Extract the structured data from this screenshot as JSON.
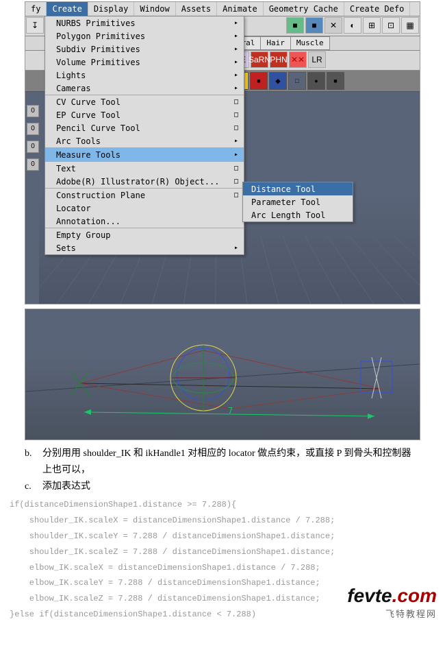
{
  "menu": {
    "items": [
      "fy",
      "Create",
      "Display",
      "Window",
      "Assets",
      "Animate",
      "Geometry Cache",
      "Create Defo"
    ],
    "selected": 1
  },
  "tabs": [
    "General",
    "Hair",
    "Muscle"
  ],
  "shelf_icons": [
    {
      "bg": "#dce",
      "txt": "EE"
    },
    {
      "bg": "#c03020",
      "color": "#fff",
      "txt": "SaRN"
    },
    {
      "bg": "#c03020",
      "color": "#fff",
      "txt": "PHN"
    },
    {
      "bg": "#e55",
      "color": "#b00",
      "txt": "✕✕"
    },
    {
      "bg": "#ccc",
      "txt": "LR"
    }
  ],
  "shelf_row2": [
    {
      "bg": "#ffd020",
      "txt": "●"
    },
    {
      "bg": "#c02020",
      "txt": "■"
    },
    {
      "bg": "#3050a0",
      "txt": "◆"
    },
    {
      "bg": "#5a6478",
      "txt": "□"
    },
    {
      "bg": "#505050",
      "txt": "●"
    },
    {
      "bg": "#555",
      "txt": "■"
    }
  ],
  "dropdown": {
    "groups": [
      [
        {
          "l": "NURBS Primitives",
          "a": 1
        },
        {
          "l": "Polygon Primitives",
          "a": 1
        },
        {
          "l": "Subdiv Primitives",
          "a": 1
        },
        {
          "l": "Volume Primitives",
          "a": 1
        },
        {
          "l": "Lights",
          "a": 1
        },
        {
          "l": "Cameras",
          "a": 1
        }
      ],
      [
        {
          "l": "CV Curve Tool",
          "o": 1
        },
        {
          "l": "EP Curve Tool",
          "o": 1
        },
        {
          "l": "Pencil Curve Tool",
          "o": 1
        },
        {
          "l": "Arc Tools",
          "a": 1
        }
      ],
      [
        {
          "l": "Measure Tools",
          "a": 1,
          "hl": 1
        }
      ],
      [
        {
          "l": "Text",
          "o": 1
        },
        {
          "l": "Adobe(R) Illustrator(R) Object...",
          "o": 1
        }
      ],
      [
        {
          "l": "Construction Plane",
          "o": 1
        },
        {
          "l": "Locator"
        },
        {
          "l": "Annotation..."
        }
      ],
      [
        {
          "l": "Empty Group"
        },
        {
          "l": "Sets",
          "a": 1
        }
      ]
    ]
  },
  "submenu": [
    {
      "l": "Distance Tool",
      "hl": 1
    },
    {
      "l": "Parameter Tool"
    },
    {
      "l": "Arc Length Tool"
    }
  ],
  "fig2_label": "7",
  "text": {
    "b": "分别用用 shoulder_IK 和 ikHandle1 对相应的 locator 做点约束，或直接 P 到骨头和控制器上也可以，",
    "c": "添加表达式"
  },
  "code": [
    "if(distanceDimensionShape1.distance >= 7.288){",
    "    shoulder_IK.scaleX = distanceDimensionShape1.distance / 7.288;",
    "    shoulder_IK.scaleY = 7.288 / distanceDimensionShape1.distance;",
    "    shoulder_IK.scaleZ = 7.288 / distanceDimensionShape1.distance;",
    "    elbow_IK.scaleX = distanceDimensionShape1.distance / 7.288;",
    "    elbow_IK.scaleY = 7.288 / distanceDimensionShape1.distance;",
    "    elbow_IK.scaleZ = 7.288 / distanceDimensionShape1.distance;",
    "}else if(distanceDimensionShape1.distance < 7.288)"
  ],
  "logo": {
    "line1a": "fevte",
    "line1b": ".com",
    "line2": "飞特教程网"
  }
}
